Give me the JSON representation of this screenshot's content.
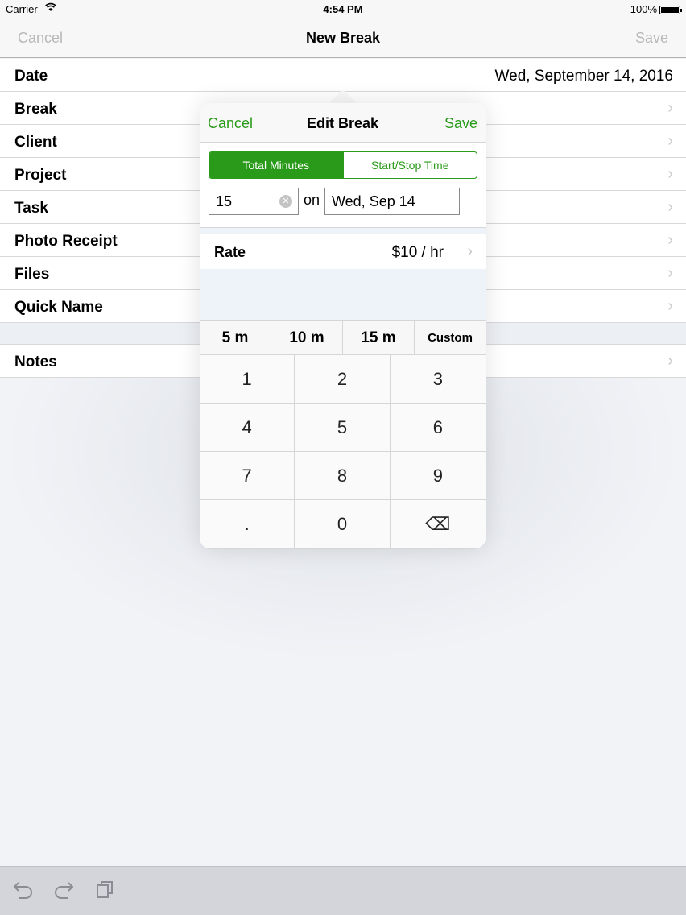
{
  "status_bar": {
    "carrier": "Carrier",
    "time": "4:54 PM",
    "battery": "100%"
  },
  "nav": {
    "cancel": "Cancel",
    "title": "New Break",
    "save": "Save"
  },
  "rows": [
    {
      "label": "Date",
      "value": "Wed,  September 14, 2016"
    },
    {
      "label": "Break"
    },
    {
      "label": "Client"
    },
    {
      "label": "Project"
    },
    {
      "label": "Task"
    },
    {
      "label": "Photo Receipt"
    },
    {
      "label": "Files"
    },
    {
      "label": "Quick Name"
    }
  ],
  "notes_row": {
    "label": "Notes"
  },
  "popover": {
    "cancel": "Cancel",
    "title": "Edit Break",
    "save": "Save",
    "segments": [
      "Total Minutes",
      "Start/Stop Time"
    ],
    "selected_segment": "Total Minutes",
    "minutes_value": "15",
    "on_label": "on",
    "date_value": "Wed, Sep 14",
    "rate_label": "Rate",
    "rate_value": "$10 / hr",
    "presets": [
      "5 m",
      "10 m",
      "15 m",
      "Custom"
    ],
    "keys": [
      "1",
      "2",
      "3",
      "4",
      "5",
      "6",
      "7",
      "8",
      "9",
      ".",
      "0",
      "⌫"
    ]
  },
  "colors": {
    "accent": "#2a9a1a",
    "disabled": "#b9b9b9"
  },
  "icons": {
    "toolbar": [
      "undo-icon",
      "redo-icon",
      "copy-icon"
    ]
  }
}
